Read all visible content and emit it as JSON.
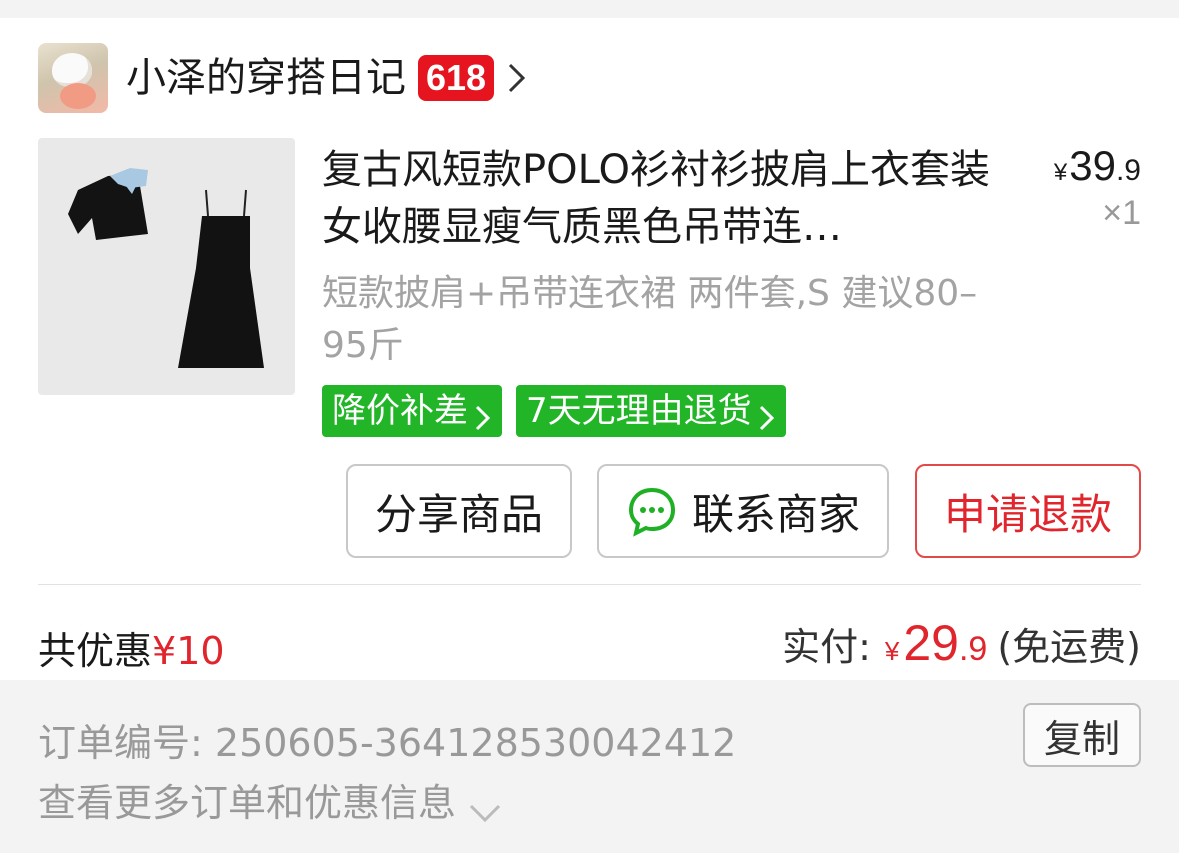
{
  "shop": {
    "name": "小泽的穿搭日记",
    "badge": "618"
  },
  "product": {
    "title": "复古风短款POLO衫衬衫披肩上衣套装女收腰显瘦气质黑色吊带连…",
    "price_symbol": "¥",
    "price_int": "39",
    "price_dec": ".9",
    "quantity": "×1",
    "spec": "短款披肩+吊带连衣裙 两件套,S 建议80–95斤",
    "tags": [
      "降价补差",
      "7天无理由退货"
    ]
  },
  "actions": {
    "share": "分享商品",
    "contact": "联系商家",
    "refund": "申请退款"
  },
  "summary": {
    "discount_label": "共优惠",
    "discount_amount": "¥10",
    "paid_label": "实付:",
    "paid_symbol": "¥",
    "paid_int": "29",
    "paid_dec": ".9",
    "shipping": "(免运费)"
  },
  "order": {
    "number_label": "订单编号:",
    "number": "250605-364128530042412",
    "copy": "复制",
    "more": "查看更多订单和优惠信息"
  },
  "colors": {
    "accent_red": "#e0262c",
    "tag_green": "#22b528",
    "badge_red": "#e5141f"
  },
  "icons": [
    "chevron-right-icon",
    "chat-bubble-icon",
    "chevron-down-icon"
  ]
}
